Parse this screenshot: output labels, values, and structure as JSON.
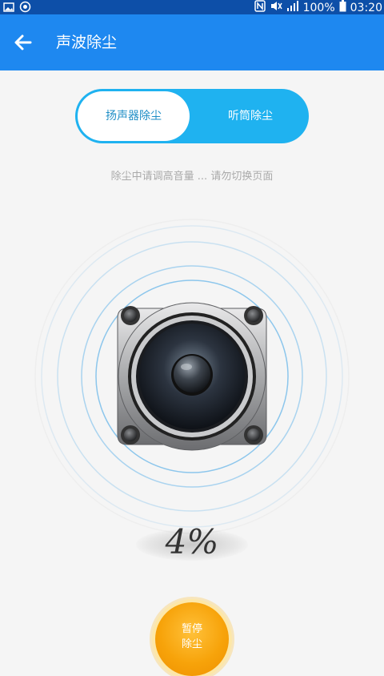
{
  "status_bar": {
    "battery_text": "100%",
    "time": "03:20",
    "icons": [
      "image-icon",
      "camera-icon",
      "nfc-icon",
      "mute-icon",
      "signal-icon",
      "battery-icon"
    ]
  },
  "app_bar": {
    "title": "声波除尘",
    "back_icon": "back-arrow-icon",
    "color": "#1e88f0"
  },
  "segments": {
    "left_label": "扬声器除尘",
    "right_label": "听筒除尘",
    "selected": "扬声器除尘",
    "accent": "#1fb2f0"
  },
  "hint_text": "除尘中请调高音量 ... 请勿切换页面",
  "progress": {
    "text": "4%",
    "value": 4
  },
  "stop_button": {
    "line1": "暂停",
    "line2": "除尘",
    "color": "#f7a30a"
  }
}
